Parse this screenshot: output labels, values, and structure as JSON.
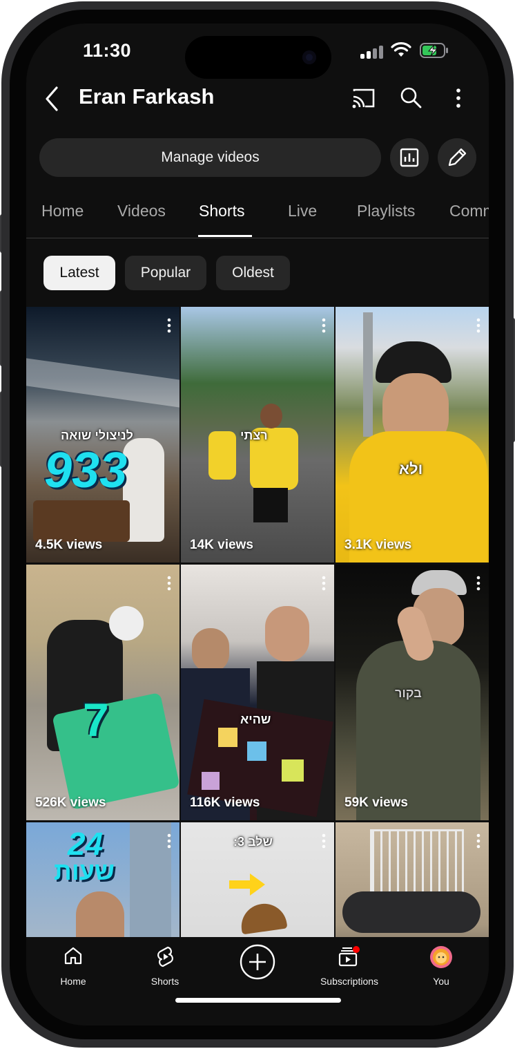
{
  "status_bar": {
    "time": "11:30"
  },
  "header": {
    "channel_name": "Eran Farkash",
    "manage_label": "Manage videos"
  },
  "tabs": [
    {
      "label": "Home"
    },
    {
      "label": "Videos"
    },
    {
      "label": "Shorts",
      "active": true
    },
    {
      "label": "Live"
    },
    {
      "label": "Playlists"
    },
    {
      "label": "Comm"
    }
  ],
  "filters": [
    {
      "label": "Latest",
      "active": true
    },
    {
      "label": "Popular"
    },
    {
      "label": "Oldest"
    }
  ],
  "shorts": [
    {
      "views": "4.5K views",
      "caption": "לניצולי שואה",
      "number": "933"
    },
    {
      "views": "14K views",
      "caption": "רצתי"
    },
    {
      "views": "3.1K views",
      "caption": "ולא"
    },
    {
      "views": "526K views",
      "number": "7"
    },
    {
      "views": "116K views",
      "caption": "שהיא"
    },
    {
      "views": "59K views",
      "caption": "בקור"
    },
    {
      "views": "",
      "number": "24",
      "caption": "שעות"
    },
    {
      "views": "",
      "caption": "שלב 3:"
    },
    {
      "views": ""
    }
  ],
  "bottom_nav": [
    {
      "label": "Home",
      "icon": "home-icon"
    },
    {
      "label": "Shorts",
      "icon": "shorts-icon"
    },
    {
      "label": "",
      "icon": "create-icon"
    },
    {
      "label": "Subscriptions",
      "icon": "subscriptions-icon"
    },
    {
      "label": "You",
      "icon": "avatar"
    }
  ],
  "colors": {
    "background": "#0f0f0f",
    "chip": "#272727",
    "accent_notification": "#ff0000"
  }
}
